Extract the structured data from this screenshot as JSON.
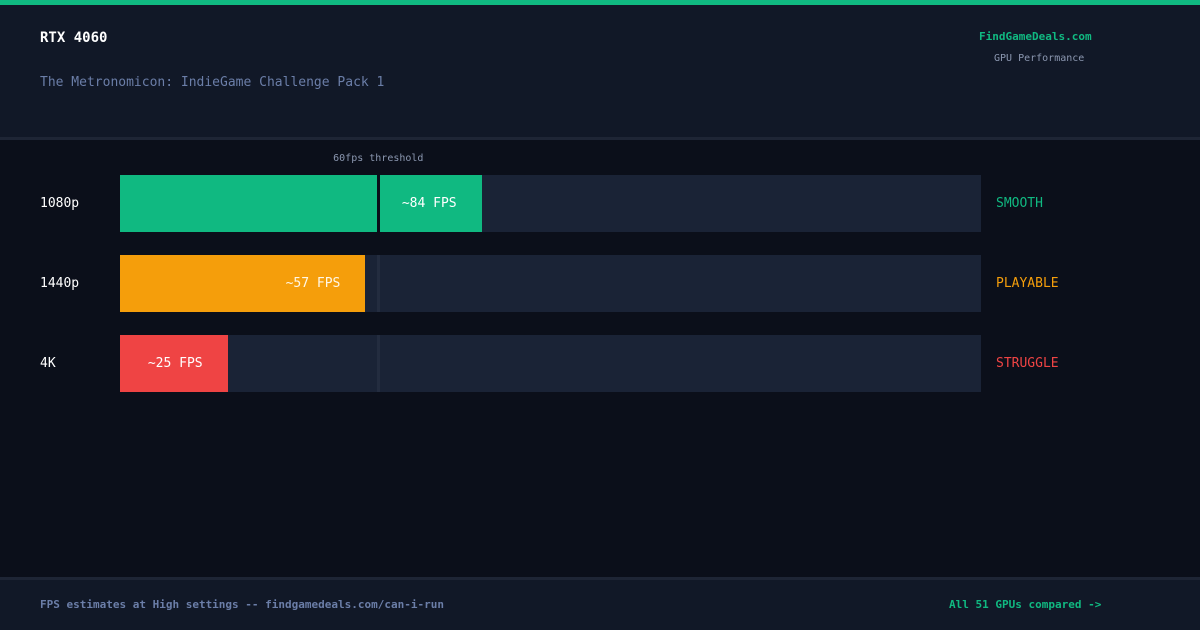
{
  "header": {
    "gpu": "RTX 4060",
    "game": "The Metronomicon: IndieGame Challenge Pack 1",
    "brand": "FindGameDeals.com",
    "brand_subtitle": "GPU Performance"
  },
  "footer": {
    "note": "FPS estimates at High settings -- findgamedeals.com/can-i-run",
    "link": "All 51 GPUs compared ->"
  },
  "colors": {
    "accent": "#10b981",
    "smooth": "#10b981",
    "playable": "#f59e0b",
    "struggle": "#ef4444",
    "track": "#1a2336",
    "threshold": "#0b0f1a"
  },
  "chart_data": {
    "type": "bar",
    "orientation": "horizontal",
    "xlim": [
      0,
      200
    ],
    "threshold": {
      "value": 60,
      "label": "60fps threshold"
    },
    "categories": [
      "1080p",
      "1440p",
      "4K"
    ],
    "values": [
      84,
      57,
      25
    ],
    "value_labels": [
      "~84 FPS",
      "~57 FPS",
      "~25 FPS"
    ],
    "statuses": [
      "SMOOTH",
      "PLAYABLE",
      "STRUGGLE"
    ]
  }
}
